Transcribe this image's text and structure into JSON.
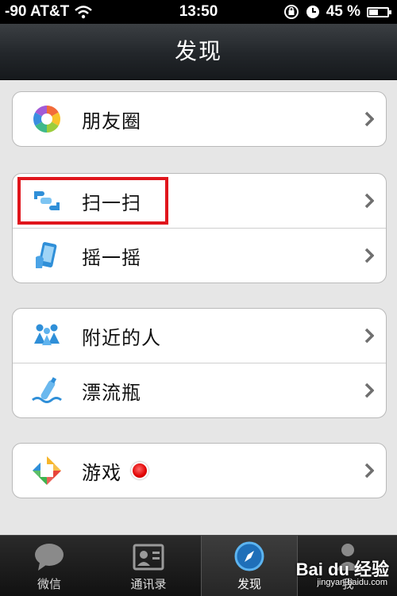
{
  "status_bar": {
    "carrier": "-90 AT&T",
    "time": "13:50",
    "battery": "45 %",
    "battery_level": 0.45
  },
  "nav": {
    "title": "发现"
  },
  "menu": [
    {
      "label": "朋友圈",
      "icon": "moments-aperture-icon"
    },
    {
      "label": "扫一扫",
      "icon": "scan-hands-icon"
    },
    {
      "label": "摇一摇",
      "icon": "shake-phone-icon"
    },
    {
      "label": "附近的人",
      "icon": "people-nearby-icon"
    },
    {
      "label": "漂流瓶",
      "icon": "drift-bottle-icon"
    },
    {
      "label": "游戏",
      "icon": "games-diamond-icon",
      "badge": "red-dot"
    }
  ],
  "tabs": [
    {
      "label": "微信",
      "icon": "chat-bubble-icon"
    },
    {
      "label": "通讯录",
      "icon": "contacts-card-icon"
    },
    {
      "label": "发现",
      "icon": "compass-icon",
      "active": true
    },
    {
      "label": "我",
      "icon": "profile-icon"
    }
  ],
  "watermark": {
    "brand": "Bai du 经验",
    "url": "jingyan.baidu.com"
  },
  "colors": {
    "highlight": "#e0151c",
    "nav_bg": "#22262a",
    "page_bg": "#e6e6e6"
  }
}
